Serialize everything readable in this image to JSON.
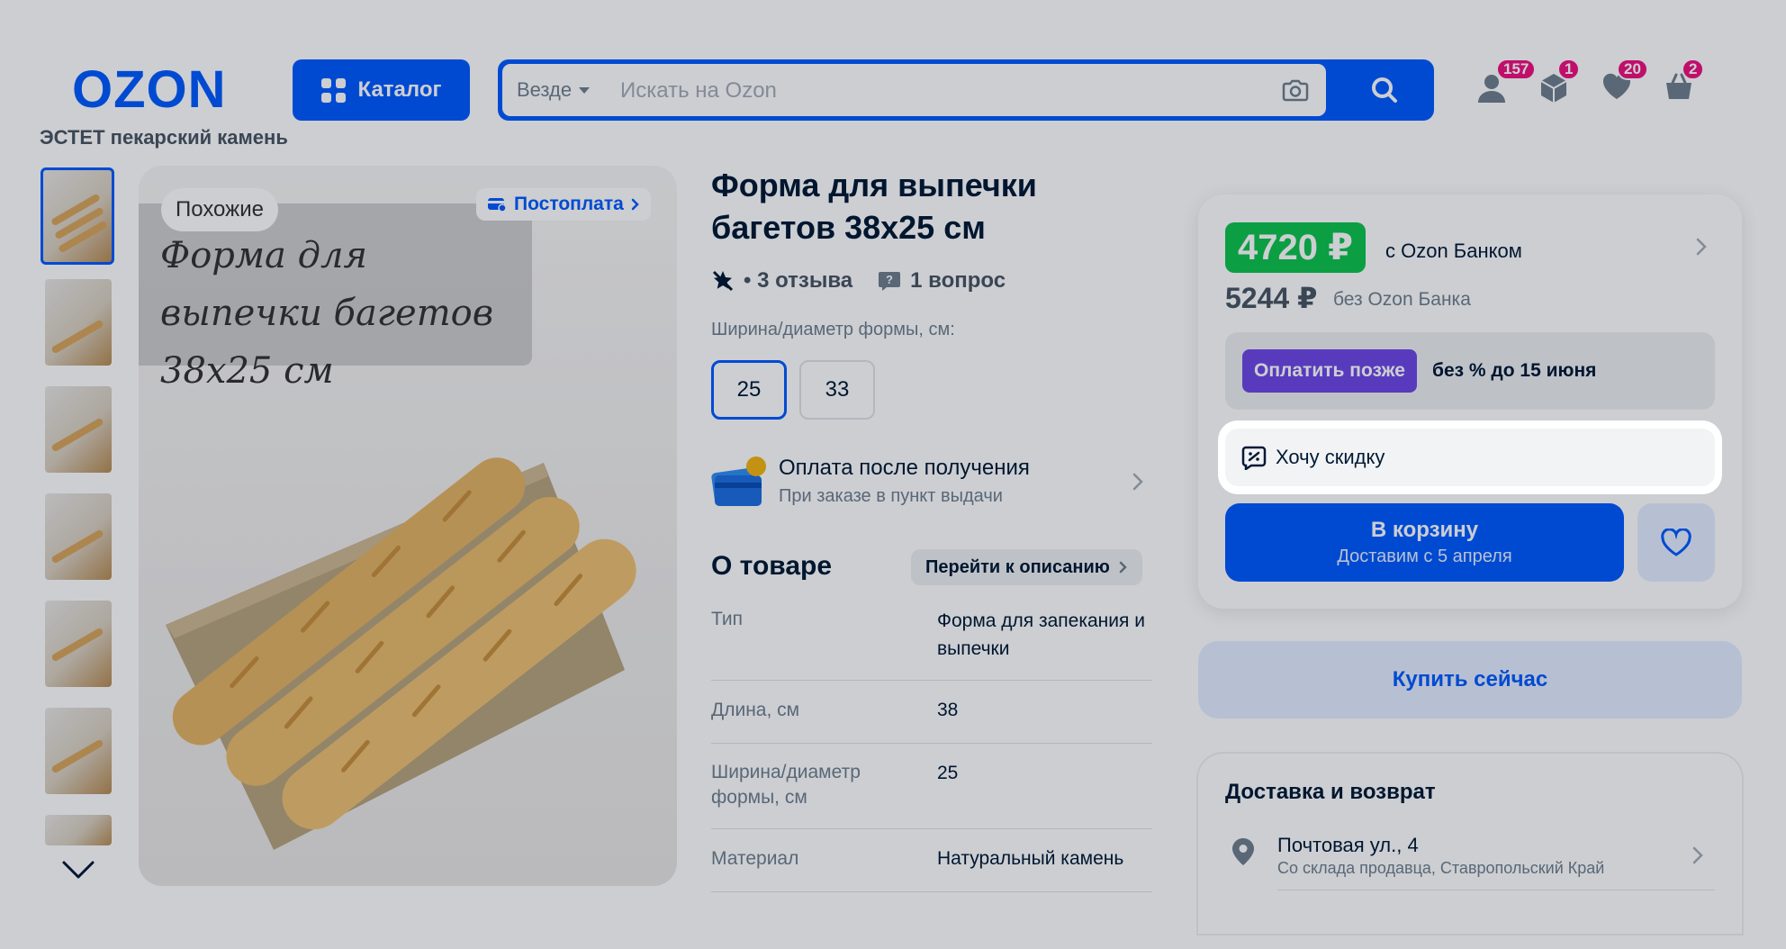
{
  "header": {
    "logo": "OZON",
    "catalog_label": "Каталог",
    "search_scope": "Везде",
    "search_placeholder": "Искать на Ozon",
    "badges": {
      "profile": "157",
      "orders": "1",
      "favorites": "20",
      "cart": "2"
    }
  },
  "breadcrumb": "ЭСТЕТ пекарский камень",
  "gallery": {
    "chip_similar": "Похожие",
    "chip_postpay": "Постоплата",
    "overlay_text": "Форма для выпечки багетов 38х25 см"
  },
  "product": {
    "title": "Форма для выпечки багетов 38х25 см",
    "reviews": "• 3 отзыва",
    "questions": "1 вопрос",
    "width_label": "Ширина/диаметр формы, см:",
    "sizes": [
      "25",
      "33"
    ],
    "selected_size": "25",
    "pay_after_title": "Оплата после получения",
    "pay_after_sub": "При заказе в пункт выдачи",
    "about_heading": "О товаре",
    "goto_description": "Перейти к описанию",
    "specs": [
      {
        "label": "Тип",
        "value": "Форма для запекания и выпечки"
      },
      {
        "label": "Длина, см",
        "value": "38"
      },
      {
        "label": "Ширина/диаметр формы, см",
        "value": "25"
      },
      {
        "label": "Материал",
        "value": "Натуральный камень"
      }
    ]
  },
  "buy_box": {
    "price_with_card": "4720 ₽",
    "with_bank": "с Ozon Банком",
    "price_without": "5244 ₽",
    "without_bank": "без Ozon Банка",
    "pay_later_label": "Оплатить позже",
    "pay_later_text": "без % до 15 июня",
    "discount_label": "Хочу скидку",
    "cart_label": "В корзину",
    "cart_sub": "Доставим с 5 апреля",
    "buy_now": "Купить сейчас"
  },
  "delivery": {
    "heading": "Доставка и возврат",
    "address": "Почтовая ул., 4",
    "source": "Со склада продавца, Ставропольский Край"
  },
  "colors": {
    "brand": "#005bff",
    "price_green": "#10c44c",
    "badge": "#f1117e",
    "pay_later": "#6e48e5"
  }
}
